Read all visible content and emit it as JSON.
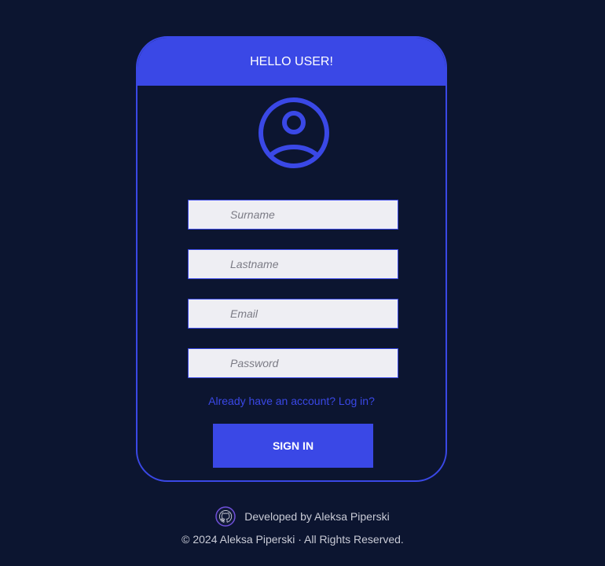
{
  "card": {
    "title": "HELLO USER!"
  },
  "form": {
    "surname_placeholder": "Surname",
    "lastname_placeholder": "Lastname",
    "email_placeholder": "Email",
    "password_placeholder": "Password",
    "login_link": "Already have an account? Log in?",
    "submit_label": "SIGN IN"
  },
  "footer": {
    "developer_text": "Developed by Aleksa Piperski",
    "copyright": "© 2024 Aleksa Piperski · All Rights Reserved."
  },
  "icons": {
    "avatar": "user-circle-icon",
    "github": "github-icon"
  },
  "colors": {
    "background": "#0c1530",
    "accent": "#3a48e6",
    "input_bg": "#eeeef3",
    "footer_text": "#c9cbd6"
  }
}
